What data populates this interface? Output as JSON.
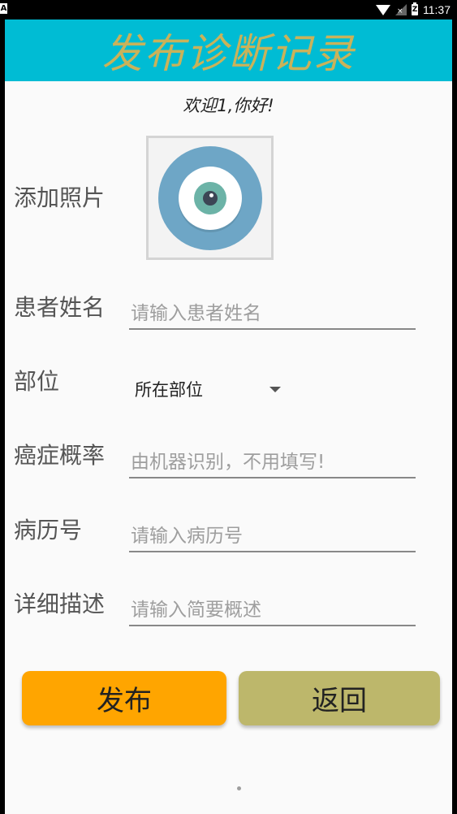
{
  "statusbar": {
    "left_badge": "A",
    "battery_text": "Z",
    "time": "11:37"
  },
  "app": {
    "title": "发布诊断记录",
    "welcome": "欢迎1,你好!",
    "colors": {
      "titlebar": "#00bcd4",
      "title_text": "#c9b25a",
      "publish_button": "#ffa500",
      "back_button": "#bdb76b"
    }
  },
  "form": {
    "photo": {
      "label": "添加照片",
      "icon": "eye-icon"
    },
    "patient_name": {
      "label": "患者姓名",
      "placeholder": "请输入患者姓名"
    },
    "location": {
      "label": "部位",
      "selected": "所在部位"
    },
    "cancer_probability": {
      "label": "癌症概率",
      "placeholder": "由机器识别，不用填写!"
    },
    "record_number": {
      "label": "病历号",
      "placeholder": "请输入病历号"
    },
    "description": {
      "label": "详细描述",
      "placeholder": "请输入简要概述"
    }
  },
  "actions": {
    "publish": "发布",
    "back": "返回"
  }
}
